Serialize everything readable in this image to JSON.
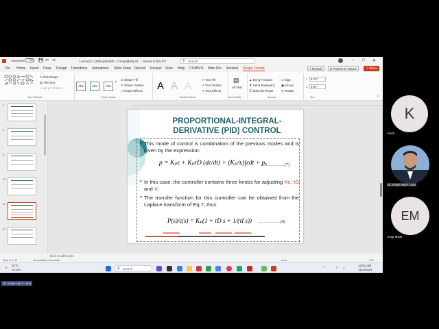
{
  "window": {
    "autosave_label": "AutoSave",
    "autosave_state": "Off",
    "file_title": "Lecture47_09thApril2020 - Compatibility M... - Saved to this PC",
    "search_placeholder": "Search"
  },
  "menu": [
    "File",
    "Home",
    "Insert",
    "Draw",
    "Design",
    "Transitions",
    "Animations",
    "Slide Show",
    "Record",
    "Review",
    "View",
    "Help",
    "COMSOL",
    "Nitro Pro",
    "Acrobat",
    "Shape Format"
  ],
  "menu_active": "Shape Format",
  "top_buttons": {
    "record": "Record",
    "present": "Present in Teams",
    "share": "Share"
  },
  "ribbon": {
    "edit_shape": "Edit Shape",
    "text_box": "Text Box",
    "merge_shapes": "Merge Shapes",
    "insert_shapes_group": "Insert Shapes",
    "style_sample": "Abc",
    "shape_fill": "Shape Fill",
    "shape_outline": "Shape Outline",
    "shape_effects": "Shape Effects",
    "shape_styles_group": "Shape Styles",
    "wordart_letter": "A",
    "wordart_group": "WordArt Styles",
    "text_fill": "Text Fill",
    "text_outline": "Text Outline",
    "text_effects": "Text Effects",
    "alt_text": "Alt Text",
    "accessibility_group": "Accessibility",
    "bring_forward": "Bring Forward",
    "send_backward": "Send Backward",
    "selection_pane": "Selection Pane",
    "align": "Align",
    "group": "Group",
    "rotate": "Rotate",
    "arrange_group": "Arrange",
    "height": "5.74\"",
    "width": "8.37\"",
    "size_group": "Size"
  },
  "thumbs": {
    "numbers": [
      "7",
      "8",
      "9",
      "10",
      "11",
      "12"
    ],
    "selected": "11"
  },
  "slide": {
    "title_line1": "PROPORTIONAL-INTEGRAL-",
    "title_line2": "DERIVATIVE (PID) CONTROL",
    "bullet1": "This mode of control is combination of the previous modes and is given by the expression:",
    "eq1": "p = Kₚε + KₚτD (dε/dt) + (Kₚ/τᵢ)∫εdt + pₒ",
    "eq1_num": "……………..(7)",
    "bullet2_pre": "In this case, the controller contains three knobs for adjusting ",
    "bullet2_kc": "Kc",
    "bullet2_sep1": ", ",
    "bullet2_td": "τD",
    "bullet2_and": " and ",
    "bullet2_ti": "τI",
    "bullet2_end": ".",
    "bullet3": "The transfer function for this controller can be obtained from the Laplace transform of Eq.7; thus",
    "eq2": "P(s)/ε(s) = Kₚ(1 + τD s + 1/(τI s))",
    "eq2_num": "……………..(8)"
  },
  "notes_placeholder": "Click to add notes",
  "status": {
    "slide": "Slide 11 of 15",
    "accessibility": "Accessibility: Unavailable",
    "notes": "Notes",
    "zoom": "74%"
  },
  "taskbar": {
    "weather_temp": "21°C",
    "weather_desc": "Smoke",
    "search": "Search",
    "time": "12:01 AM",
    "date": "12/1/2024"
  },
  "participants": [
    {
      "initial": "K",
      "name": "Kash"
    },
    {
      "initial": "",
      "name": "Dr. Imran Nazir Unar"
    },
    {
      "initial": "EM",
      "name": "Engr MSM"
    }
  ],
  "presenter_label": "Dr. Imran Nazir Unar",
  "colors": {
    "accent": "#c43e1c",
    "heading": "#1f5f6a",
    "teal": "#2a8a8f",
    "highlight": "#e0401a"
  }
}
